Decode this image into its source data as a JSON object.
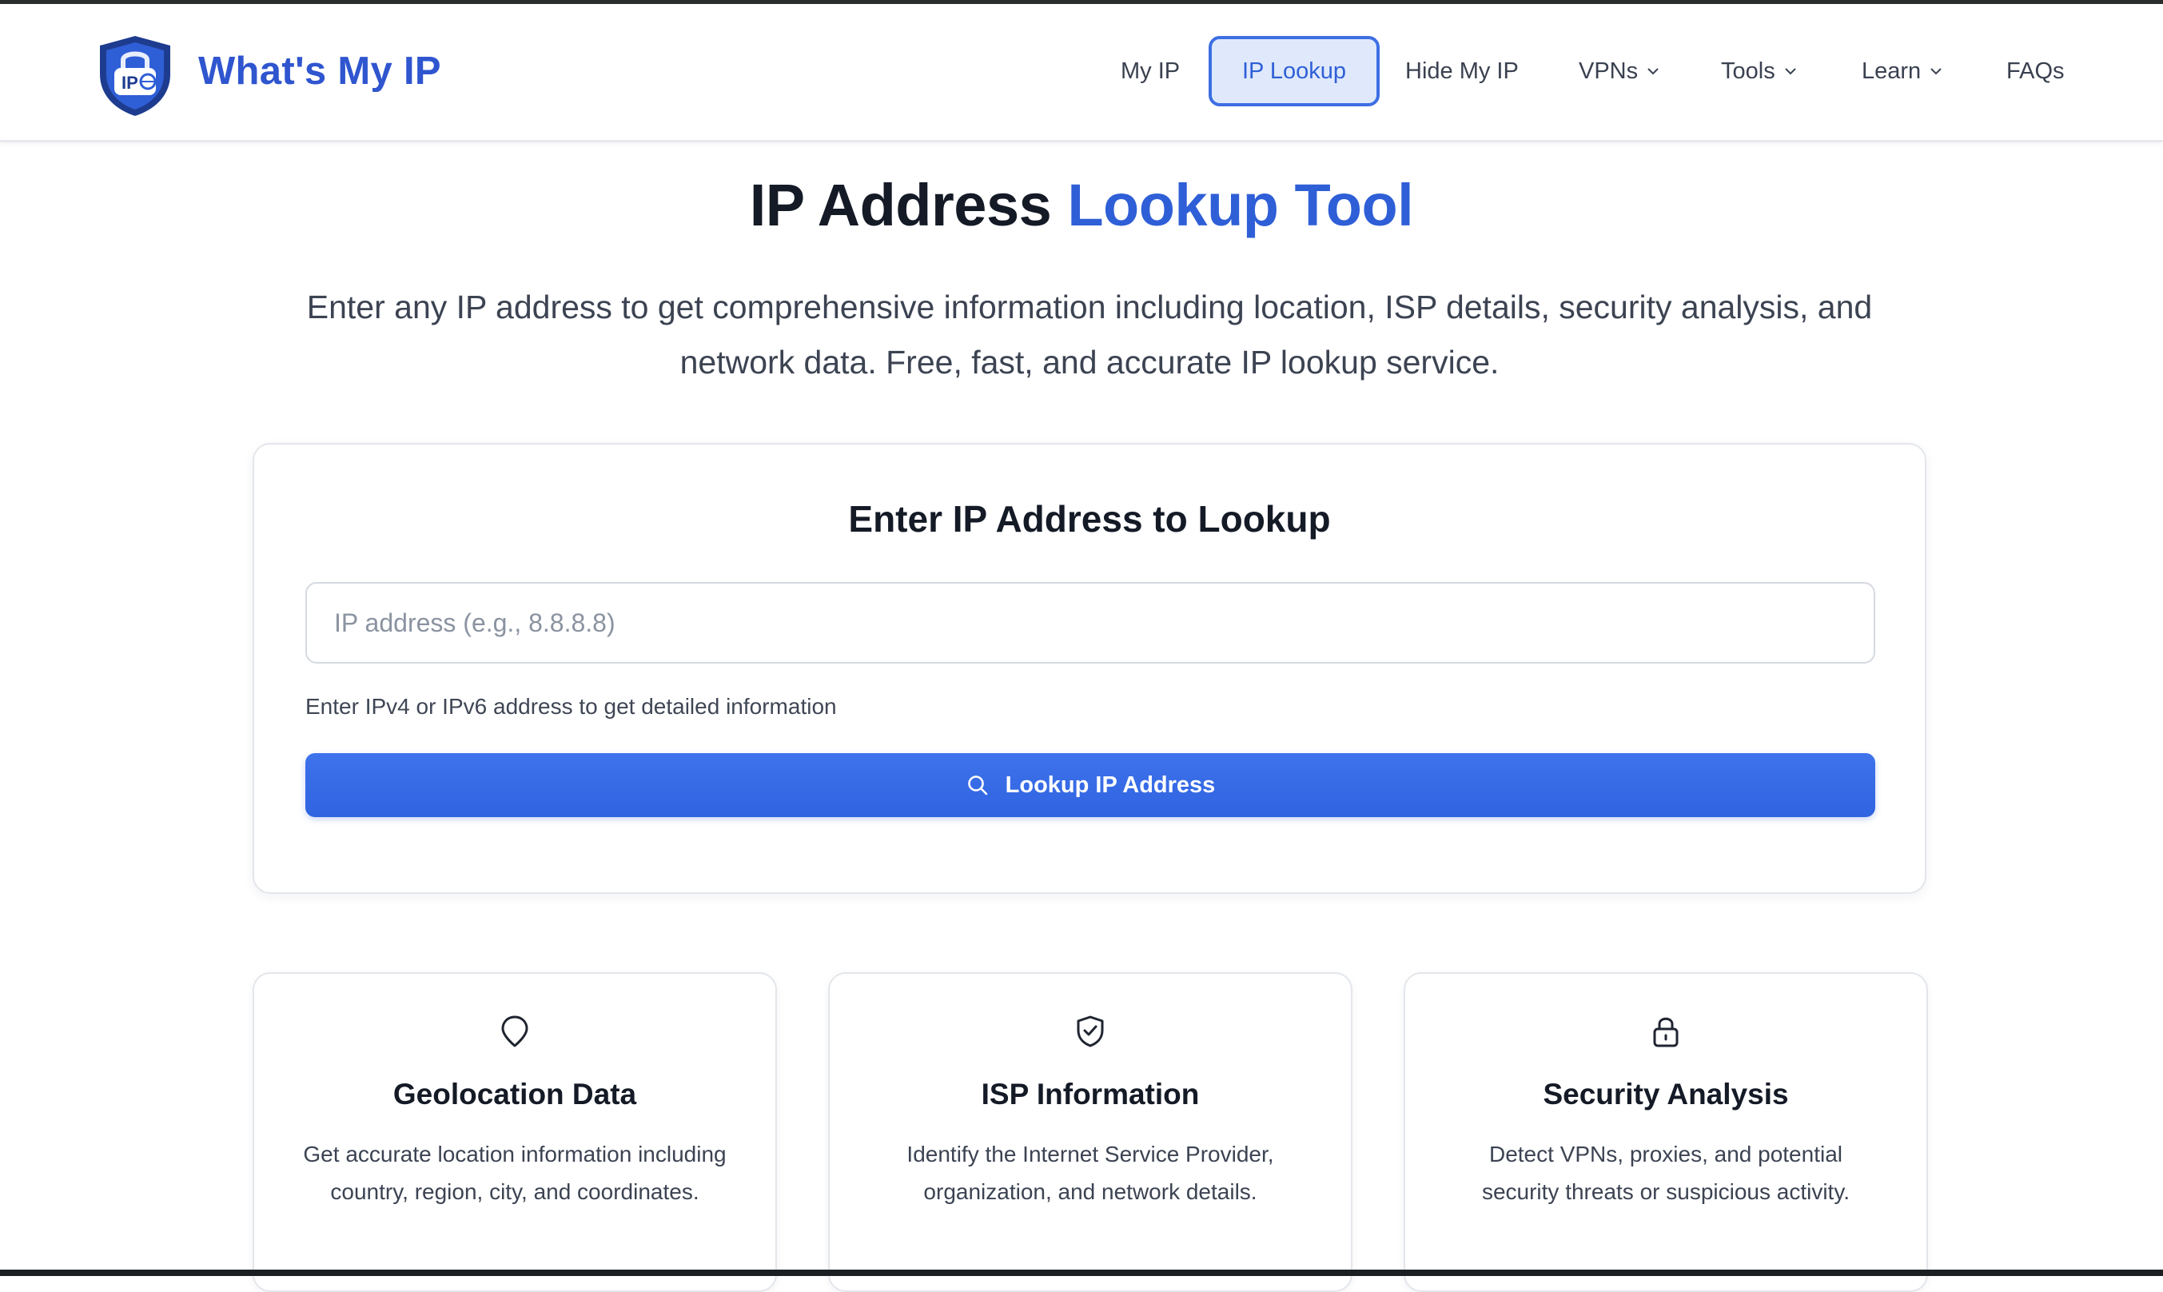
{
  "header": {
    "brand": "What's My IP",
    "logo_text": "IP",
    "nav": [
      {
        "label": "My IP"
      },
      {
        "label": "IP Lookup",
        "active": true
      },
      {
        "label": "Hide My IP"
      },
      {
        "label": "VPNs",
        "dropdown": true
      },
      {
        "label": "Tools",
        "dropdown": true
      },
      {
        "label": "Learn",
        "dropdown": true
      },
      {
        "label": "FAQs"
      }
    ]
  },
  "hero": {
    "title_part1": "IP Address",
    "title_part2": "Lookup Tool",
    "description": "Enter any IP address to get comprehensive information including location, ISP details, security analysis, and network data. Free, fast, and accurate IP lookup service."
  },
  "lookup": {
    "heading": "Enter IP Address to Lookup",
    "input_value": "",
    "input_placeholder": "IP address (e.g., 8.8.8.8)",
    "helper": "Enter IPv4 or IPv6 address to get detailed information",
    "button_label": "Lookup IP Address",
    "button_icon": "search-icon"
  },
  "features": [
    {
      "icon": "map-pin-icon",
      "title": "Geolocation Data",
      "description": "Get accurate location information including country, region, city, and coordinates."
    },
    {
      "icon": "shield-check-icon",
      "title": "ISP Information",
      "description": "Identify the Internet Service Provider, organization, and network details."
    },
    {
      "icon": "lock-icon",
      "title": "Security Analysis",
      "description": "Detect VPNs, proxies, and potential security threats or suspicious activity."
    }
  ],
  "colors": {
    "accent": "#2f5fd7",
    "brand": "#2f55cf",
    "button": "#3a6ee8",
    "heading": "#141a26"
  }
}
